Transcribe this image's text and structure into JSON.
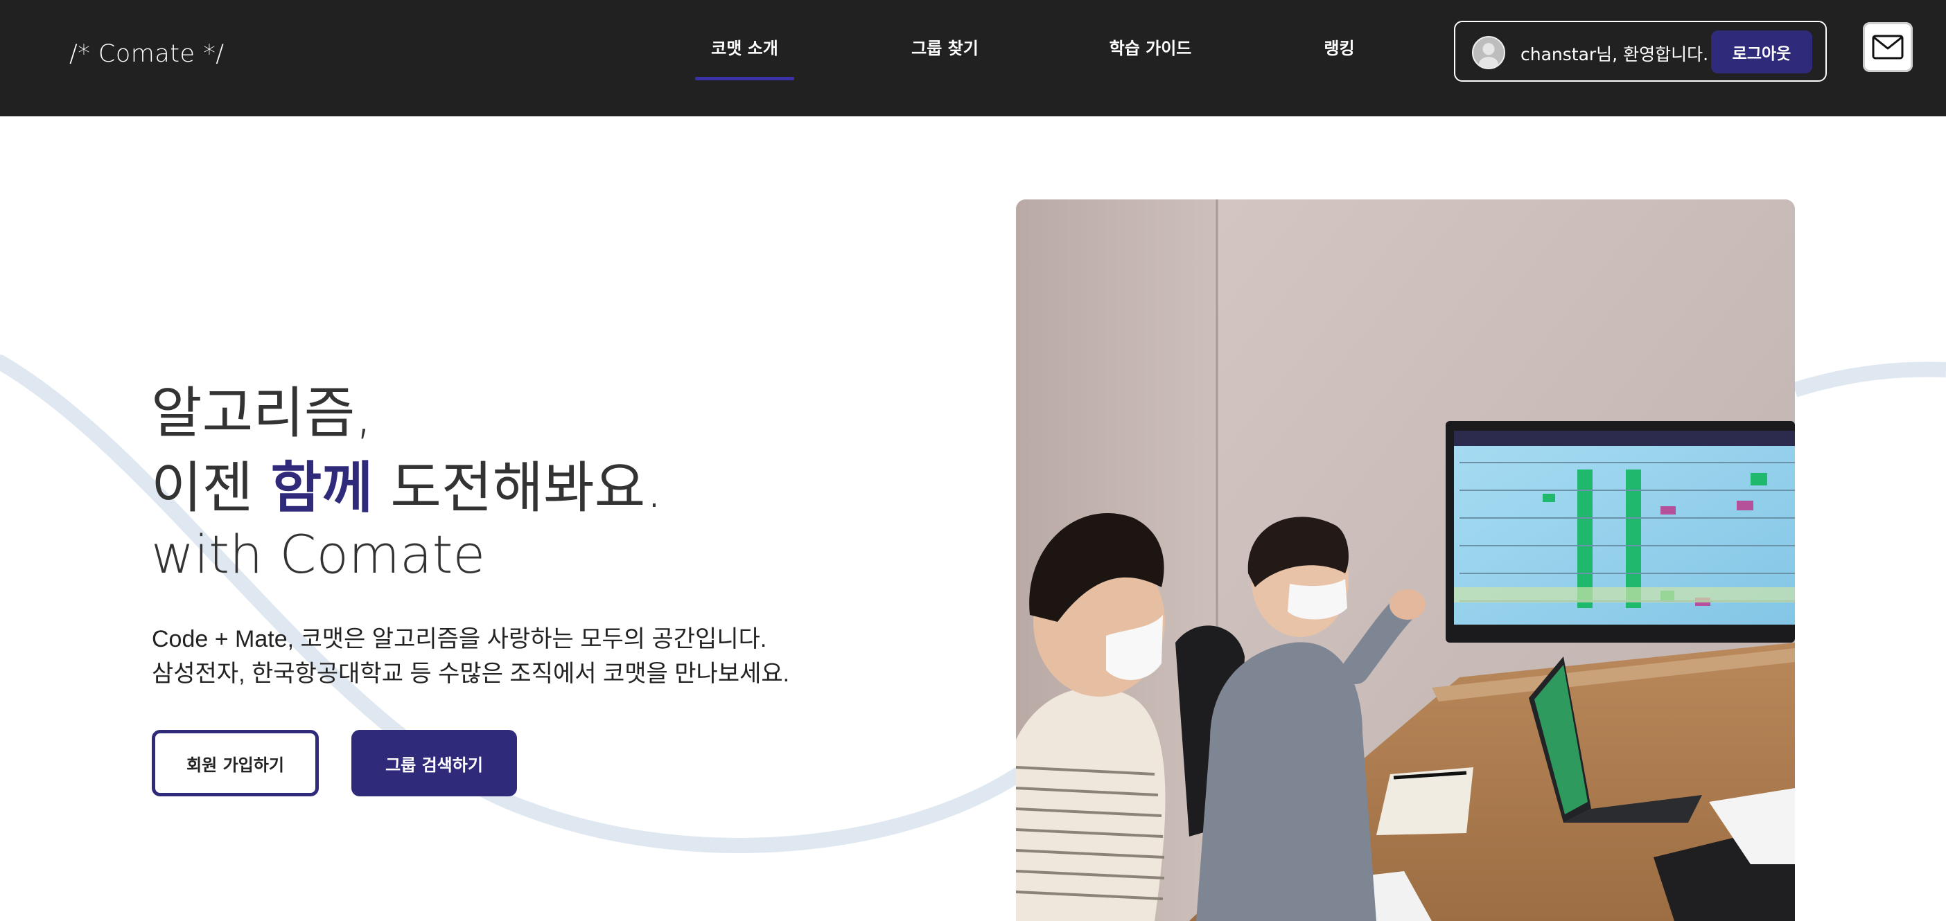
{
  "header": {
    "logo": "/* Comate */",
    "nav": [
      {
        "label": "코맷 소개",
        "active": true
      },
      {
        "label": "그룹 찾기",
        "active": false
      },
      {
        "label": "학습 가이드",
        "active": false
      },
      {
        "label": "랭킹",
        "active": false
      }
    ],
    "user": {
      "welcome": "chanstar님, 환영합니다.",
      "logout_label": "로그아웃"
    },
    "mail_icon": "mail-icon"
  },
  "hero": {
    "line1": "알고리즘,",
    "line2_pre": "이젠 ",
    "line2_strong": "함께",
    "line2_post": " 도전해봐요.",
    "line3": "with Comate",
    "desc1": "Code + Mate, 코맷은 알고리즘을 사랑하는 모두의 공간입니다.",
    "desc2": "삼성전자, 한국항공대학교 등 수많은 조직에서 코맷을 만나보세요.",
    "signup_label": "회원 가입하기",
    "search_label": "그룹 검색하기"
  },
  "colors": {
    "header_bg": "#212121",
    "accent": "#2f2b7a",
    "wave": "#dfe8f1"
  }
}
